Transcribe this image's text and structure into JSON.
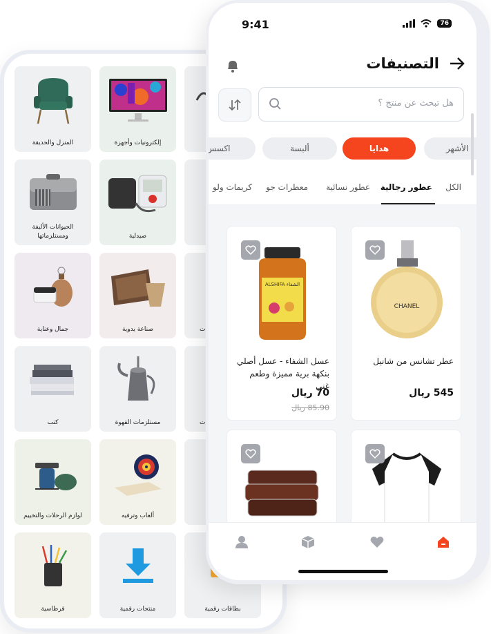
{
  "colors": {
    "accent": "#f5451f",
    "muted": "#a4a7ad"
  },
  "back_phone": {
    "categories": [
      {
        "label": "المنزل والحديقة",
        "icon": "armchair-icon",
        "bg": "#eef0f2"
      },
      {
        "label": "إلكترونيات وأجهزة",
        "icon": "monitor-icon",
        "bg": "#eaf0ec"
      },
      {
        "label": "الحيوانات الأليفة ومستلزماتها",
        "icon": "pet-carrier-icon",
        "bg": "#eef0f2"
      },
      {
        "label": "صيدلية",
        "icon": "blood-pressure-monitor-icon",
        "bg": "#eaf0ec"
      },
      {
        "label": "جمال وعناية",
        "icon": "cosmetics-icon",
        "bg": "#eeeaf0"
      },
      {
        "label": "صناعة يدوية",
        "icon": "handcraft-icon",
        "bg": "#f3ecec"
      },
      {
        "label": "كتب",
        "icon": "books-icon",
        "bg": "#eef0f2"
      },
      {
        "label": "مستلزمات القهوة",
        "icon": "coffee-pot-icon",
        "bg": "#eef0f2"
      },
      {
        "label": "لوازم الرحلات والتخييم",
        "icon": "camping-stove-icon",
        "bg": "#eef1e8"
      },
      {
        "label": "ألعاب وترفيه",
        "icon": "dartboard-icon",
        "bg": "#f2f2ea"
      },
      {
        "label": "قرطاسية",
        "icon": "stationery-icon",
        "bg": "#f2f2ea"
      },
      {
        "label": "منتجات رقمية",
        "icon": "download-icon",
        "bg": "#eef0f2"
      },
      {
        "label": "بطاقات رقمية",
        "icon": "gift-card-icon",
        "bg": "#eef0f2"
      }
    ],
    "partial_labels": [
      "ت",
      "ت"
    ]
  },
  "front_phone": {
    "status": {
      "time": "9:41",
      "battery": "76"
    },
    "header": {
      "title": "التصنيفات"
    },
    "search": {
      "placeholder": "هل تبحث عن منتج ؟"
    },
    "chips": [
      "الأشهر",
      "هدايا",
      "ألبسة",
      "اكسس"
    ],
    "active_chip": "هدايا",
    "subtabs": [
      "الكل",
      "عطور رجالية",
      "عطور نسائية",
      "معطرات جو",
      "كريمات ولو"
    ],
    "active_subtab": "عطور رجالية",
    "products": [
      {
        "name": "عطر تشانس من شانيل",
        "price": "545 ريال",
        "old_price": "",
        "image": "perfume-icon"
      },
      {
        "name": "عسل الشفاء - عسل أصلي بنكهة برية مميزة وطعم غني",
        "price": "70 ريال",
        "old_price": "85.90 ريال",
        "image": "honey-jar-icon",
        "jar_label": "ALSHIFA الشفاء"
      },
      {
        "name": "",
        "price": "",
        "old_price": "",
        "image": "tshirt-icon"
      },
      {
        "name": "",
        "price": "",
        "old_price": "",
        "image": "dates-icon"
      }
    ],
    "perfume_label": "CHANEL",
    "bottom_nav": [
      "home-icon",
      "heart-icon",
      "box-icon",
      "profile-icon"
    ]
  }
}
